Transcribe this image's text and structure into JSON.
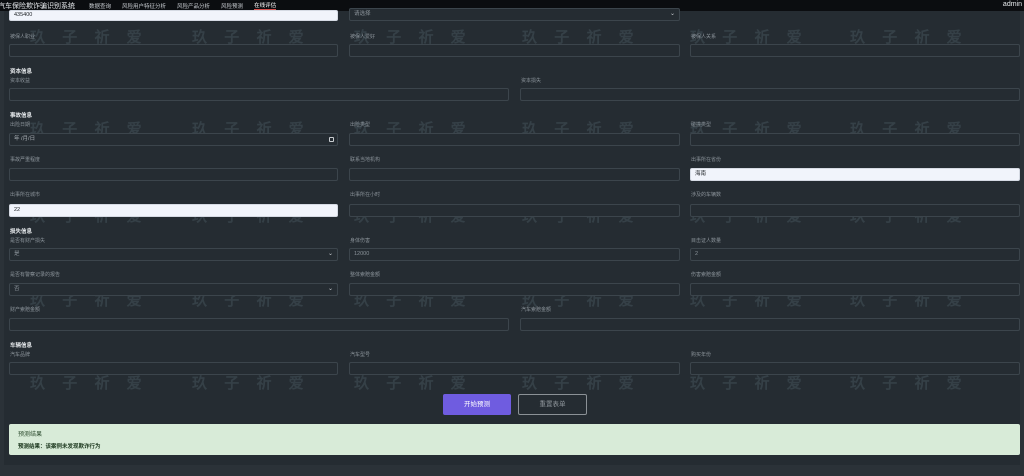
{
  "nav": {
    "brand": "汽车保险欺诈骗识别系统",
    "items": [
      "数据查询",
      "风险用户特征分析",
      "风险产品分析",
      "风险预测",
      "在线评估"
    ],
    "user": "admin"
  },
  "watermark": "玖 子 祈 爱",
  "form": {
    "top_value": "435400",
    "top_select": "请选择",
    "insured": {
      "labels": [
        "被保人职业",
        "被保人爱好",
        "被保人关系"
      ]
    },
    "capital": {
      "title": "资本信息",
      "labels": [
        "资本收益",
        "资本损失"
      ]
    },
    "accident": {
      "title": "事故信息",
      "labels": [
        "出险日期",
        "出险类型",
        "碰撞类型",
        "事故严重程度",
        "联系当地机构",
        "出事所在省份",
        "出事所在城市",
        "出事所在小时",
        "涉及的车辆数"
      ],
      "date_placeholder": "年 /月/日",
      "province": "海南",
      "city": "22"
    },
    "loss": {
      "title": "损失信息",
      "labels": [
        "是否有财产损失",
        "身体伤害",
        "目击证人数量",
        "是否有警察记录的报告",
        "整体索赔金额",
        "伤害索赔金额",
        "财产索赔金额",
        "汽车索赔金额"
      ],
      "property_loss": "是",
      "bodily_injury": "12000",
      "witnesses": "2",
      "police_report": "否"
    },
    "vehicle": {
      "title": "车辆信息",
      "labels": [
        "汽车品牌",
        "汽车型号",
        "购买年份"
      ]
    }
  },
  "buttons": {
    "predict": "开始预测",
    "reset": "重置表单"
  },
  "result": {
    "title": "预测结果",
    "text": "预测结果：该案例未发现欺诈行为"
  }
}
